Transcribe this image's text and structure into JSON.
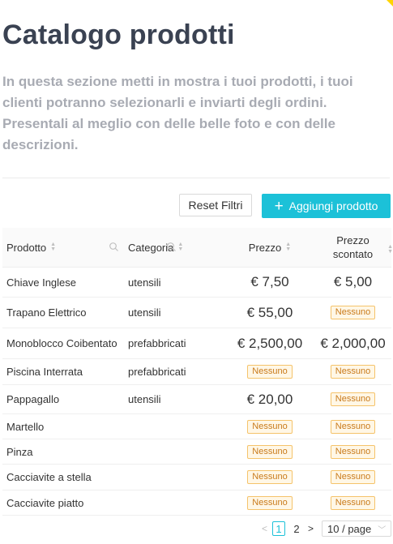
{
  "page": {
    "title": "Catalogo prodotti",
    "description": "In questa sezione metti in mostra i tuoi prodotti, i tuoi clienti potranno selezionarli e inviarti degli ordini. Presentali al meglio con delle belle foto e con delle descrizioni."
  },
  "toolbar": {
    "reset_label": "Reset Filtri",
    "add_label": "Aggiungi prodotto"
  },
  "table": {
    "columns": {
      "product": "Prodotto",
      "category": "Categoria",
      "price": "Prezzo",
      "discounted_line1": "Prezzo",
      "discounted_line2": "scontato"
    },
    "rows": [
      {
        "product": "Chiave Inglese",
        "category": "utensili",
        "price": "€ 7,50",
        "discounted": "€ 5,00"
      },
      {
        "product": "Trapano Elettrico",
        "category": "utensili",
        "price": "€ 55,00",
        "discounted": "Nessuno"
      },
      {
        "product": "Monoblocco Coibentato",
        "category": "prefabbricati",
        "price": "€ 2,500,00",
        "discounted": "€ 2,000,00"
      },
      {
        "product": "Piscina Interrata",
        "category": "prefabbricati",
        "price": "Nessuno",
        "discounted": "Nessuno"
      },
      {
        "product": "Pappagallo",
        "category": "utensili",
        "price": "€ 20,00",
        "discounted": "Nessuno"
      },
      {
        "product": "Martello",
        "category": "",
        "price": "Nessuno",
        "discounted": "Nessuno"
      },
      {
        "product": "Pinza",
        "category": "",
        "price": "Nessuno",
        "discounted": "Nessuno"
      },
      {
        "product": "Cacciavite a stella",
        "category": "",
        "price": "Nessuno",
        "discounted": "Nessuno"
      },
      {
        "product": "Cacciavite piatto",
        "category": "",
        "price": "Nessuno",
        "discounted": "Nessuno"
      }
    ],
    "empty_tag": "Nessuno"
  },
  "pagination": {
    "pages": [
      "1",
      "2"
    ],
    "current": "1",
    "page_size": "10 / page"
  },
  "colors": {
    "accent": "#1cc1d8",
    "title": "#3a4252",
    "description": "#a8abb3",
    "tag_text": "#c97a1a",
    "tag_bg": "#fff7e6",
    "corner": "#ffd400"
  }
}
